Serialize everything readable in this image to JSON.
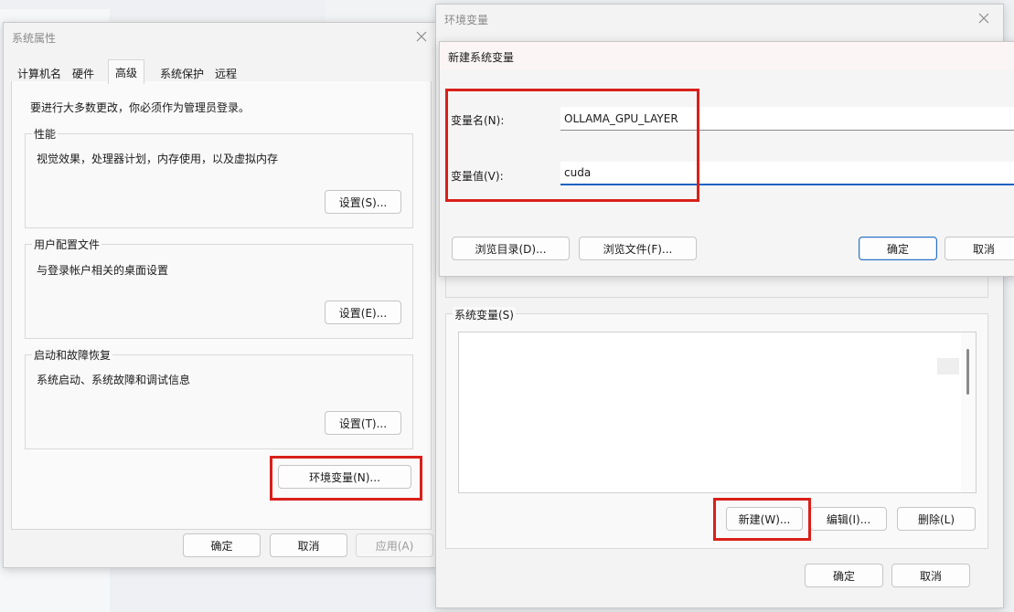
{
  "sys_props": {
    "title": "系统属性",
    "tabs": [
      "计算机名",
      "硬件",
      "高级",
      "系统保护",
      "远程"
    ],
    "admin_note": "要进行大多数更改，你必须作为管理员登录。",
    "perf": {
      "label": "性能",
      "desc": "视觉效果，处理器计划，内存使用，以及虚拟内存",
      "button": "设置(S)..."
    },
    "profile": {
      "label": "用户配置文件",
      "desc": "与登录帐户相关的桌面设置",
      "button": "设置(E)..."
    },
    "startup": {
      "label": "启动和故障恢复",
      "desc": "系统启动、系统故障和调试信息",
      "button": "设置(T)..."
    },
    "env_button": "环境变量(N)...",
    "ok": "确定",
    "cancel": "取消",
    "apply": "应用(A)"
  },
  "env_vars": {
    "title": "环境变量",
    "system_vars_label": "系统变量(S)",
    "new_button": "新建(W)...",
    "edit_button": "编辑(I)...",
    "delete_button": "删除(L)",
    "ok": "确定",
    "cancel": "取消"
  },
  "new_var": {
    "title": "新建系统变量",
    "name_label": "变量名(N):",
    "name_value": "OLLAMA_GPU_LAYER",
    "value_label": "变量值(V):",
    "value_value": "cuda",
    "browse_dir": "浏览目录(D)...",
    "browse_file": "浏览文件(F)...",
    "ok": "确定",
    "cancel": "取消"
  },
  "colors": {
    "highlight_red": "#d9201a",
    "focus_blue": "#1c62c2"
  }
}
